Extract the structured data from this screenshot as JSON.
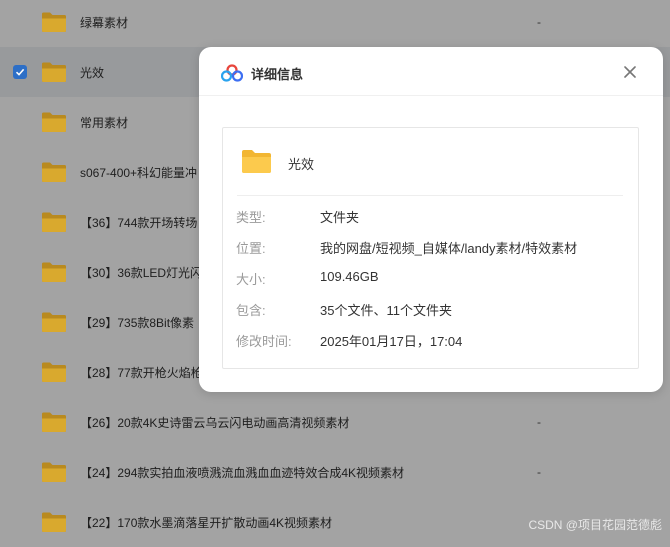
{
  "file_list": {
    "rows": [
      {
        "name": "绿幕素材",
        "size": "-",
        "selected": false
      },
      {
        "name": "光效",
        "size": "",
        "selected": true
      },
      {
        "name": "常用素材",
        "size": "",
        "selected": false
      },
      {
        "name": "s067-400+科幻能量冲",
        "size": "",
        "selected": false
      },
      {
        "name": "【36】744款开场转场",
        "size": "",
        "selected": false
      },
      {
        "name": "【30】36款LED灯光闪",
        "size": "",
        "selected": false
      },
      {
        "name": "【29】735款8Bit像素",
        "size": "",
        "selected": false
      },
      {
        "name": "【28】77款开枪火焰枪",
        "size": "",
        "selected": false
      },
      {
        "name": "【26】20款4K史诗雷云乌云闪电动画高清视频素材",
        "size": "-",
        "selected": false
      },
      {
        "name": "【24】294款实拍血液喷溅流血溅血血迹特效合成4K视频素材",
        "size": "-",
        "selected": false
      },
      {
        "name": "【22】170款水墨滴落星开扩散动画4K视频素材",
        "size": "",
        "selected": false
      }
    ]
  },
  "dialog": {
    "title": "详细信息",
    "logo_icon": "cloud-drive-logo-icon",
    "close_icon": "close-icon",
    "folder_name": "光效",
    "properties": [
      {
        "key": "类型:",
        "value": "文件夹"
      },
      {
        "key": "位置:",
        "value": "我的网盘/短视频_自媒体/landy素材/特效素材"
      },
      {
        "key": "大小:",
        "value": "109.46GB"
      },
      {
        "key": "包含:",
        "value": "35个文件、11个文件夹"
      },
      {
        "key": "修改时间:",
        "value": "2025年01月17日，17:04"
      }
    ]
  },
  "watermark": "CSDN @项目花园范德彪",
  "colors": {
    "overlay": "#a3a3a3",
    "folder": "#d9a92e",
    "checkbox": "#2d6fc7",
    "dialog_bg": "#ffffff"
  }
}
